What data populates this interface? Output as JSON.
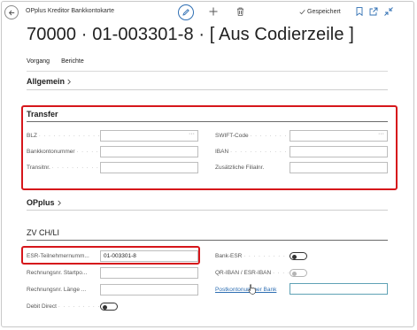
{
  "header": {
    "page_caption": "OPplus Kreditor Bankkontokarte",
    "saved_status": "Gespeichert",
    "record_title": "70000 · 01-003301-8 · [ Aus Codierzeile ]"
  },
  "actions": [
    "Vorgang",
    "Berichte"
  ],
  "sections": {
    "allgemein": "Allgemein",
    "transfer": "Transfer",
    "opplus": "OPplus",
    "zv": "ZV CH/LI"
  },
  "transfer": {
    "blz": {
      "label": "BLZ",
      "value": ""
    },
    "bankkontonummer": {
      "label": "Bankkontonummer",
      "value": ""
    },
    "transitnr": {
      "label": "Transitnr.",
      "value": ""
    },
    "swift_code": {
      "label": "SWIFT-Code",
      "value": ""
    },
    "iban": {
      "label": "IBAN",
      "value": ""
    },
    "zusaetzliche_filialnr": {
      "label": "Zusätzliche Filialnr.",
      "value": ""
    },
    "assist_glyph": "···"
  },
  "zv": {
    "esr_teilnehmernummer": {
      "label": "ESR-Teilnehmernumm...",
      "value": "01-003301-8"
    },
    "rechnungsnr_startpo": {
      "label": "Rechnungsnr. Startpo...",
      "value": ""
    },
    "rechnungsnr_laenge": {
      "label": "Rechnungsnr. Länge ...",
      "value": ""
    },
    "debit_direct": {
      "label": "Debit Direct",
      "value": false
    },
    "bank_esr": {
      "label": "Bank-ESR",
      "value": false
    },
    "qr_iban_esr_iban": {
      "label": "QR-IBAN / ESR-IBAN",
      "value": false
    },
    "postkontonummer_bank": {
      "label": "Postkontonummer Bank",
      "value": ""
    }
  },
  "colors": {
    "highlight": "#d6161b",
    "accent": "#2f6fb3"
  },
  "icons": [
    "back-arrow-icon",
    "edit-pencil-icon",
    "plus-icon",
    "trash-icon",
    "checkmark-icon",
    "bookmark-icon",
    "popout-icon",
    "collapse-icon",
    "chevron-right-icon",
    "pointer-cursor-icon"
  ]
}
